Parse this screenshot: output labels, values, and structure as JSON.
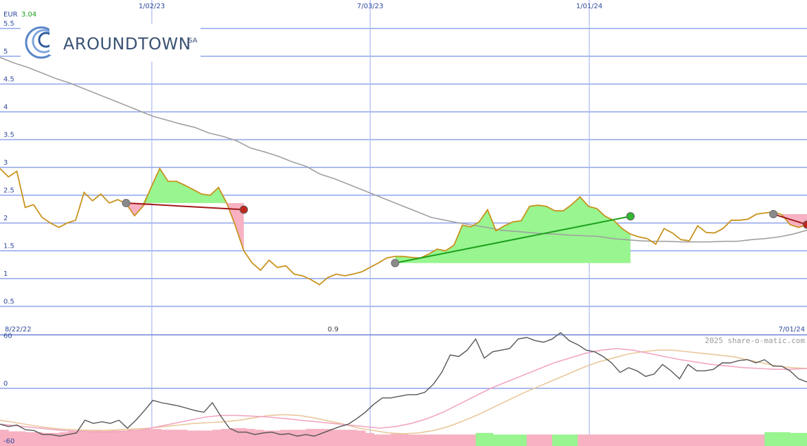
{
  "chart_data": {
    "type": "line",
    "currency_label": "EUR",
    "last_price": "3.04",
    "start_date_label": "8/22/22",
    "end_date_label": "7/01/24",
    "mid_label": "0.9",
    "watermark": "2025 share-o-matic.com",
    "brand": {
      "name": "AROUNDTOWN",
      "suffix": "SA"
    },
    "x_ticks": [
      "1/02/23",
      "7/03/23",
      "1/01/24"
    ],
    "y_ticks": [
      "5.5",
      "5",
      "4.5",
      "4",
      "3.5",
      "3",
      "2.5",
      "2",
      "1.5",
      "1",
      "0.5"
    ],
    "ylim": [
      0,
      5.5
    ],
    "grid": true,
    "series": [
      {
        "values": [
          2.98,
          2.83,
          2.93,
          2.28,
          2.33,
          2.1,
          2.0,
          1.92,
          2.0,
          2.05,
          2.55,
          2.4,
          2.52,
          2.36,
          2.42,
          2.35,
          2.13,
          2.3,
          2.65,
          2.98,
          2.75,
          2.75,
          2.68,
          2.6,
          2.52,
          2.5,
          2.64,
          2.35,
          1.95,
          1.5,
          1.28,
          1.15,
          1.33,
          1.2,
          1.23,
          1.08,
          1.05,
          0.98,
          0.89,
          1.02,
          1.08,
          1.05,
          1.08,
          1.12,
          1.2,
          1.28,
          1.37,
          1.4,
          1.4,
          1.38,
          1.37,
          1.44,
          1.53,
          1.5,
          1.6,
          1.96,
          1.93,
          2.02,
          2.24,
          1.86,
          1.95,
          2.02,
          2.04,
          2.3,
          2.32,
          2.3,
          2.22,
          2.22,
          2.33,
          2.47,
          2.3,
          2.26,
          2.12,
          2.05,
          1.9,
          1.8,
          1.75,
          1.72,
          1.62,
          1.9,
          1.82,
          1.7,
          1.68,
          1.95,
          1.83,
          1.82,
          1.9,
          2.05,
          2.05,
          2.07,
          2.16,
          2.18,
          2.2,
          2.15,
          1.97,
          1.92,
          1.97
        ],
        "color": "#c8921c"
      },
      {
        "values": [
          4.98,
          4.88,
          4.8,
          4.7,
          4.6,
          4.52,
          4.42,
          4.32,
          4.22,
          4.12,
          4.02,
          3.92,
          3.85,
          3.78,
          3.72,
          3.62,
          3.56,
          3.48,
          3.35,
          3.28,
          3.2,
          3.1,
          3.02,
          2.88,
          2.8,
          2.7,
          2.6,
          2.5,
          2.4,
          2.3,
          2.2,
          2.1,
          2.05,
          2.0,
          1.96,
          1.92,
          1.87,
          1.85,
          1.83,
          1.81,
          1.8,
          1.78,
          1.77,
          1.76,
          1.72,
          1.7,
          1.68,
          1.67,
          1.67,
          1.66,
          1.66,
          1.66,
          1.67,
          1.67,
          1.7,
          1.72,
          1.75,
          1.8,
          1.87
        ],
        "color": "#a0a0a0"
      }
    ],
    "signal_trades": [
      {
        "buy_price": 2.36,
        "sell_price": 2.24,
        "result": "loss"
      },
      {
        "buy_price": 1.28,
        "sell_price": 2.12,
        "result": "gain"
      },
      {
        "buy_price": 2.16,
        "sell_price": 1.97,
        "result": "loss"
      }
    ],
    "oscillator": {
      "y_ticks": [
        "60",
        "0",
        "-60"
      ],
      "ylim": [
        -60,
        60
      ],
      "line": [
        -45,
        -48,
        -46,
        -52,
        -53,
        -58,
        -58,
        -60,
        -58,
        -56,
        -40,
        -44,
        -42,
        -44,
        -40,
        -50,
        -40,
        -28,
        -15,
        -18,
        -20,
        -22,
        -25,
        -28,
        -30,
        -18,
        -35,
        -50,
        -55,
        -55,
        -58,
        -56,
        -55,
        -58,
        -57,
        -60,
        -58,
        -60,
        -56,
        -52,
        -48,
        -45,
        -38,
        -30,
        -20,
        -12,
        -12,
        -10,
        -8,
        -8,
        -5,
        5,
        20,
        42,
        40,
        48,
        62,
        38,
        46,
        48,
        50,
        62,
        64,
        60,
        58,
        62,
        70,
        60,
        55,
        48,
        46,
        40,
        32,
        20,
        26,
        22,
        15,
        18,
        30,
        22,
        12,
        30,
        22,
        22,
        24,
        32,
        32,
        35,
        36,
        32,
        36,
        28,
        28,
        22,
        12,
        8
      ],
      "signal_fast": [
        -45,
        -47,
        -49,
        -51,
        -53,
        -54,
        -55,
        -55,
        -54,
        -52,
        -48,
        -44,
        -40,
        -36,
        -34,
        -34,
        -35,
        -36,
        -38,
        -40,
        -42,
        -44,
        -46,
        -48,
        -50,
        -48,
        -44,
        -38,
        -30,
        -20,
        -10,
        0,
        8,
        16,
        24,
        32,
        38,
        44,
        48,
        50,
        48,
        44,
        40,
        36,
        33,
        30,
        28,
        26,
        25,
        24,
        24,
        25
      ],
      "signal_slow": [
        -40,
        -43,
        -46,
        -49,
        -51,
        -52,
        -53,
        -53,
        -52,
        -51,
        -50,
        -48,
        -46,
        -44,
        -43,
        -42,
        -40,
        -37,
        -34,
        -33,
        -34,
        -37,
        -41,
        -45,
        -50,
        -53,
        -56,
        -57,
        -56,
        -53,
        -48,
        -41,
        -33,
        -24,
        -15,
        -6,
        2,
        10,
        18,
        26,
        33,
        38,
        43,
        46,
        48,
        48,
        46,
        44,
        42,
        40,
        36,
        32,
        28,
        26,
        25
      ],
      "histogram": [
        -52,
        -54,
        -54,
        -55,
        -55,
        -56,
        -56,
        -55,
        -54,
        -53,
        -52,
        -52,
        -53,
        -53,
        -53,
        -52,
        -52,
        -51,
        -51,
        -52,
        -52,
        -52,
        -53,
        -53,
        -53,
        -52,
        -51,
        -50,
        -50,
        -51,
        -52,
        -53,
        -53,
        -52,
        -52,
        -52,
        -51,
        -51,
        -51,
        -52,
        -52,
        -52,
        -53,
        -56,
        -58,
        -58,
        -57,
        -57,
        -58,
        -58,
        -58,
        -58,
        -58,
        -58,
        -58,
        -58,
        -56,
        -56,
        -58,
        -58,
        -58,
        -58,
        -58,
        -58,
        -58,
        -58,
        -58,
        -58,
        -58,
        -58,
        -58,
        -58,
        -58,
        -58,
        -58,
        -58,
        -58,
        -58,
        -58,
        -58,
        -58,
        -58,
        -58,
        -58,
        -58,
        -58,
        -58,
        -58,
        -58,
        -58,
        -55,
        -55,
        -55,
        -56,
        -56
      ],
      "histogram_up": [
        false,
        false,
        false,
        false,
        false,
        false,
        false,
        false,
        false,
        false,
        false,
        false,
        false,
        false,
        false,
        false,
        false,
        false,
        false,
        false,
        false,
        false,
        false,
        false,
        false,
        false,
        false,
        false,
        false,
        false,
        false,
        false,
        false,
        false,
        false,
        false,
        false,
        false,
        false,
        false,
        false,
        false,
        false,
        false,
        false,
        false,
        false,
        false,
        false,
        false,
        false,
        false,
        false,
        false,
        false,
        false,
        true,
        true,
        true,
        true,
        true,
        true,
        false,
        false,
        false,
        true,
        true,
        true,
        false,
        false,
        false,
        false,
        false,
        false,
        false,
        false,
        false,
        false,
        false,
        false,
        false,
        false,
        false,
        false,
        false,
        false,
        false,
        false,
        false,
        false,
        true,
        true,
        true,
        true,
        true
      ]
    }
  }
}
